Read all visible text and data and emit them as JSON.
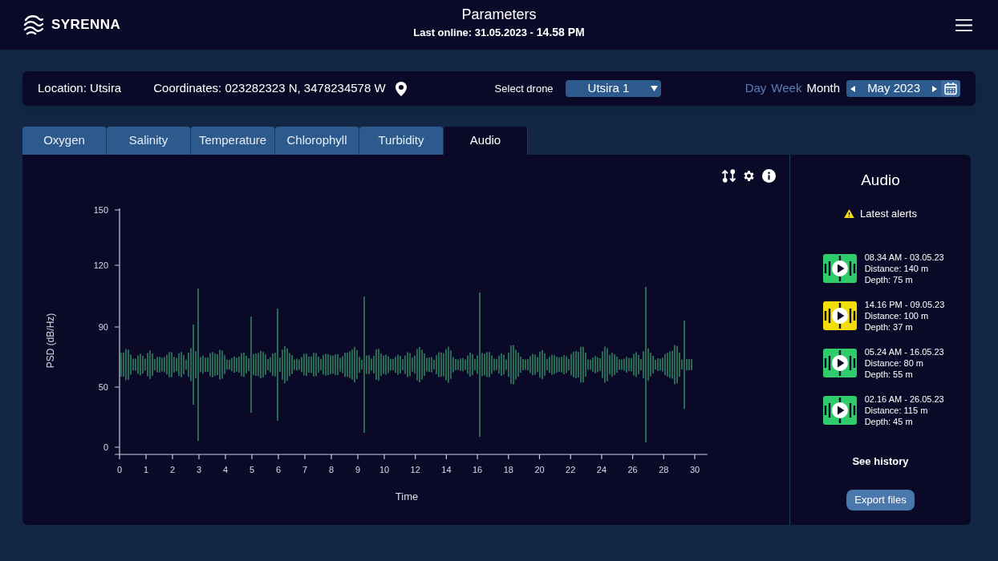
{
  "header": {
    "brand": "SYRENNA",
    "title": "Parameters",
    "subtitle_label": "Last online: 31.05.2023 - ",
    "subtitle_time": "14.58 PM"
  },
  "filter_bar": {
    "location": "Location: Utsira",
    "coordinates": "Coordinates: 023282323 N, 3478234578 W",
    "drone_label": "Select drone",
    "drone_value": "Utsira 1",
    "periods": [
      {
        "label": "Day",
        "selected": false
      },
      {
        "label": "Week",
        "selected": false
      },
      {
        "label": "Month",
        "selected": true
      }
    ],
    "period_value": "May 2023"
  },
  "tabs": [
    {
      "label": "Oxygen",
      "selected": false
    },
    {
      "label": "Salinity",
      "selected": false
    },
    {
      "label": "Temperature",
      "selected": false
    },
    {
      "label": "Chlorophyll",
      "selected": false
    },
    {
      "label": "Turbidity",
      "selected": false
    },
    {
      "label": "Audio",
      "selected": true
    }
  ],
  "waveform_plot": {
    "ylabel": "PSD (dB/Hz)",
    "xlabel": "Time",
    "yticks": [
      "150",
      "120",
      "90",
      "50",
      "0"
    ],
    "xticks": [
      "0",
      "1",
      "2",
      "3",
      "4",
      "5",
      "6",
      "7",
      "8",
      "9",
      "10",
      "12",
      "14",
      "16",
      "18",
      "20",
      "22",
      "24",
      "26",
      "28",
      "30"
    ]
  },
  "side_panel": {
    "title": "Audio",
    "alerts_heading": "Latest alerts",
    "alerts": [
      {
        "time": "08.34 AM - 03.05.23",
        "distance": "Distance: 140 m",
        "depth": "Depth: 75 m",
        "color": "#2ecc6a"
      },
      {
        "time": "14.16 PM - 09.05.23",
        "distance": "Distance: 100 m",
        "depth": "Depth: 37 m",
        "color": "#f2dc0a"
      },
      {
        "time": "05.24 AM - 16.05.23",
        "distance": "Distance: 80 m",
        "depth": "Depth: 55 m",
        "color": "#2ecc6a"
      },
      {
        "time": "02.16 AM - 26.05.23",
        "distance": "Distance: 115 m",
        "depth": "Depth: 45 m",
        "color": "#2ecc6a"
      }
    ],
    "history_link": "See history",
    "export_button": "Export files"
  }
}
